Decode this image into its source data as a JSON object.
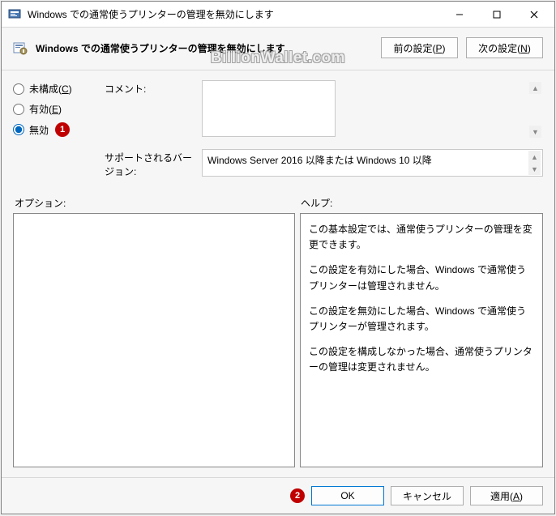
{
  "window": {
    "title": "Windows での通常使うプリンターの管理を無効にします"
  },
  "header": {
    "title": "Windows での通常使うプリンターの管理を無効にします",
    "prev_label": "前の設定(P)",
    "next_label": "次の設定(N)"
  },
  "radios": {
    "not_configured": "未構成(C)",
    "enabled": "有効(E)",
    "disabled": "無効",
    "selected": "disabled"
  },
  "badges": {
    "one": "1",
    "two": "2"
  },
  "mid": {
    "comment_label": "コメント:",
    "comment_value": "",
    "supported_label": "サポートされるバージョン:",
    "supported_value": "Windows Server 2016 以降または Windows 10 以降"
  },
  "subhead": {
    "options": "オプション:",
    "help": "ヘルプ:"
  },
  "help_paragraphs": {
    "p1": "この基本設定では、通常使うプリンターの管理を変更できます。",
    "p2": "この設定を有効にした場合、Windows で通常使うプリンターは管理されません。",
    "p3": "この設定を無効にした場合、Windows で通常使うプリンターが管理されます。",
    "p4": "この設定を構成しなかった場合、通常使うプリンターの管理は変更されません。"
  },
  "buttons": {
    "ok": "OK",
    "cancel": "キャンセル",
    "apply": "適用(A)"
  },
  "watermark": "BillionWallet.com"
}
